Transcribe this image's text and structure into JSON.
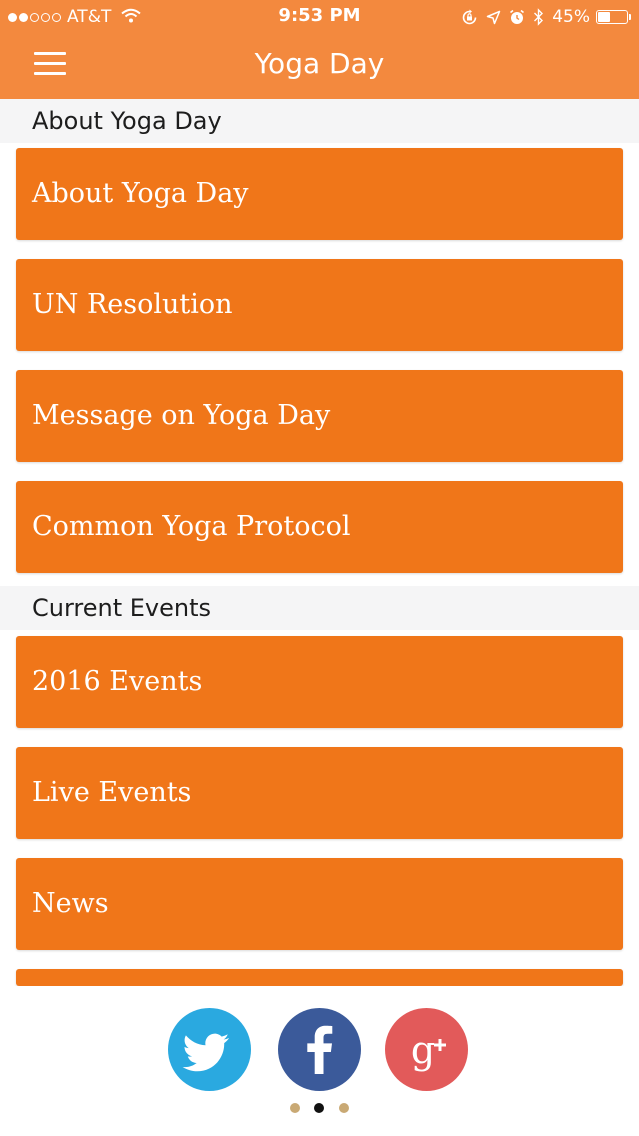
{
  "status_bar": {
    "carrier": "AT&T",
    "time": "9:53 PM",
    "battery_percent": "45%",
    "battery_level": 0.45,
    "signal_bars_filled": 2,
    "signal_bars_total": 5
  },
  "nav": {
    "title": "Yoga Day",
    "menu_icon": "hamburger-menu-icon"
  },
  "sections": [
    {
      "title": "About Yoga Day",
      "items": [
        "About Yoga Day",
        "UN Resolution",
        "Message on Yoga Day",
        "Common Yoga Protocol"
      ]
    },
    {
      "title": "Current Events",
      "items": [
        "2016 Events",
        "Live Events",
        "News"
      ]
    }
  ],
  "footer": {
    "social": [
      "twitter-icon",
      "facebook-icon",
      "google-plus-icon"
    ],
    "page_dots": 3,
    "active_page_dot": 2
  },
  "colors": {
    "header": "#f3893e",
    "tile": "#f07619",
    "section_bg": "#f5f5f6",
    "twitter": "#2aa9e0",
    "facebook": "#3b5a9a",
    "google_plus": "#e25a5a",
    "dot_inactive": "#c9a974",
    "dot_active": "#111111"
  }
}
